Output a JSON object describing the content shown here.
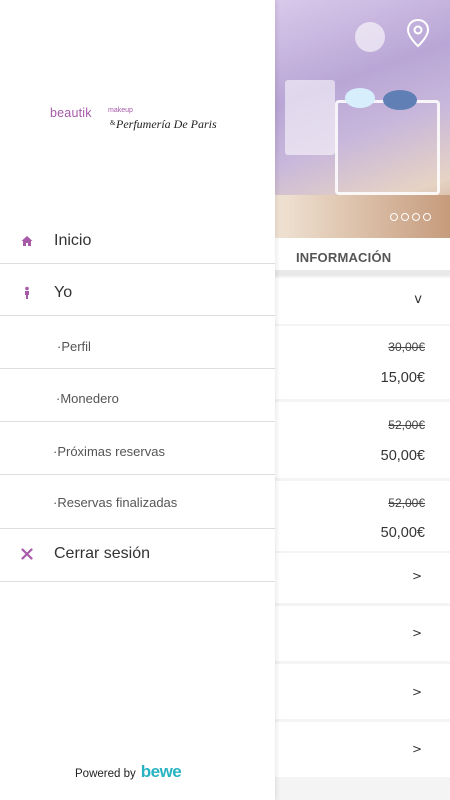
{
  "colors": {
    "accent": "#a65aa8",
    "brand_bewe": "#27b3c1",
    "divider": "#dddddd"
  },
  "background": {
    "section_title": "INFORMACIÓN",
    "collapse_chevron": "v",
    "prices": [
      {
        "old": "30,00€",
        "new": "15,00€"
      },
      {
        "old": "52,00€",
        "new": "50,00€"
      },
      {
        "old": "52,00€",
        "new": "50,00€"
      }
    ],
    "row_chevron": ">",
    "icons": {
      "location": "location-pin-icon",
      "carousel": "carousel-dots"
    }
  },
  "drawer": {
    "logo": {
      "brand": "beautik",
      "brand_suffix": "makeup",
      "amp": "&",
      "partner": "Perfumería De Paris"
    },
    "menu": {
      "inicio": {
        "label": "Inicio",
        "icon": "home-icon"
      },
      "yo": {
        "label": "Yo",
        "icon": "person-icon"
      },
      "perfil": {
        "label": "·Perfil"
      },
      "monedero": {
        "label": "·Monedero"
      },
      "proximas": {
        "label": "·Próximas reservas"
      },
      "finalizadas": {
        "label": "·Reservas finalizadas"
      },
      "logout": {
        "label": "Cerrar sesión",
        "icon": "close-icon"
      }
    },
    "footer": {
      "powered_by": "Powered by",
      "brand": "bewe"
    }
  }
}
